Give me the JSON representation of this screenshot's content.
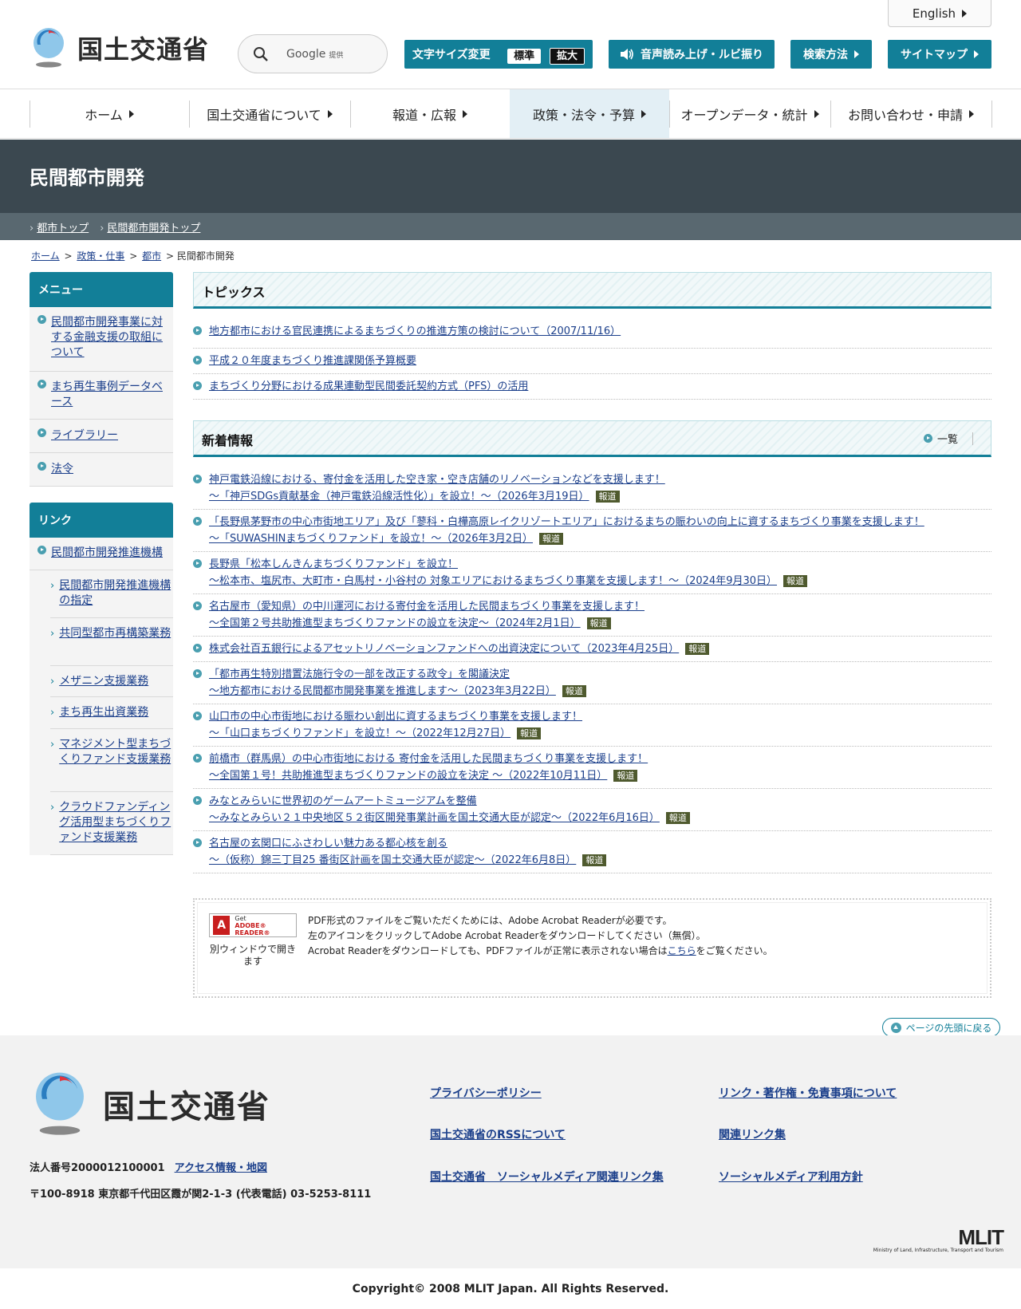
{
  "header": {
    "english_label": "English",
    "logo_text": "国土交通省",
    "search_label": "Google",
    "search_provided": "提供",
    "fontsize_label": "文字サイズ変更",
    "fontsize_standard": "標準",
    "fontsize_large": "拡大",
    "voice_label": "音声読み上げ・ルビ振り",
    "howto_label": "検索方法",
    "sitemap_label": "サイトマップ"
  },
  "nav": {
    "items": [
      "ホーム",
      "国土交通省について",
      "報道・広報",
      "政策・法令・予算",
      "オープンデータ・統計",
      "お問い合わせ・申請"
    ],
    "active_index": 3
  },
  "banner": {
    "title": "民間都市開発",
    "subnav": [
      "都市トップ",
      "民間都市開発トップ"
    ]
  },
  "breadcrumb": {
    "links": [
      "ホーム",
      "政策・仕事",
      "都市"
    ],
    "sep": ">",
    "current": "民間都市開発"
  },
  "sidebar": {
    "menu_title": "メニュー",
    "menu_items": [
      "民間都市開発事業に対する金融支援の取組について",
      "まち再生事例データベース",
      "ライブラリー",
      "法令"
    ],
    "link_title": "リンク",
    "link_items": [
      "民間都市開発推進機構"
    ],
    "link_subitems": [
      "民間都市開発推進機構の指定",
      "共同型都市再構築業務",
      "メザニン支援業務",
      "まち再生出資業務",
      "マネジメント型まちづくりファンド支援業務",
      "クラウドファンディング活用型まちづくりファンド支援業務"
    ]
  },
  "topics": {
    "title": "トピックス",
    "items": [
      "地方都市における官民連携によるまちづくりの推進方策の検討について（2007/11/16）",
      "平成２０年度まちづくり推進課関係予算概要",
      "まちづくり分野における成果連動型民間委託契約方式（PFS）の活用"
    ]
  },
  "news": {
    "title": "新着情報",
    "list_label": "一覧",
    "badge": "報道",
    "items": [
      {
        "line1": "神戸電鉄沿線における、寄付金を活用した空き家・空き店舗のリノベーションなどを支援します！",
        "line2": "～「神戸SDGs貢献基金（神戸電鉄沿線活性化）」を設立！～（2026年3月19日）"
      },
      {
        "line1": "「長野県茅野市の中心市街地エリア」及び「蓼科・白樺高原レイクリゾートエリア」におけるまちの賑わいの向上に資するまちづくり事業を支援します！",
        "line2": "～「SUWASHINまちづくりファンド」を設立！～（2026年3月2日）"
      },
      {
        "line1": "長野県「松本しんきんまちづくりファンド」を設立！",
        "line2": "～松本市、塩尻市、大町市・白馬村・小谷村の 対象エリアにおけるまちづくり事業を支援します！～（2024年9月30日）"
      },
      {
        "line1": "名古屋市（愛知県）の中川運河における寄付金を活用した民間まちづくり事業を支援します！",
        "line2": "～全国第２号共助推進型まちづくりファンドの設立を決定～（2024年2月1日）"
      },
      {
        "line1": "株式会社百五銀行によるアセットリノベーションファンドへの出資決定について（2023年4月25日）",
        "line2": ""
      },
      {
        "line1": "「都市再生特別措置法施行令の一部を改正する政令」を閣議決定",
        "line2": "～地方都市における民間都市開発事業を推進します～（2023年3月22日）"
      },
      {
        "line1": "山口市の中心市街地における賑わい創出に資するまちづくり事業を支援します！",
        "line2": "～「山口まちづくりファンド」を設立！～（2022年12月27日）"
      },
      {
        "line1": "前橋市（群馬県）の中心市街地における 寄付金を活用した民間まちづくり事業を支援します！",
        "line2": "～全国第１号！共助推進型まちづくりファンドの設立を決定 ～（2022年10月11日）"
      },
      {
        "line1": "みなとみらいに世界初のゲームアートミュージアムを整備",
        "line2": "～みなとみらい２１中央地区５２街区開発事業計画を国土交通大臣が認定～（2022年6月16日）"
      },
      {
        "line1": "名古屋の玄関口にふさわしい魅力ある都心核を創る",
        "line2": "～（仮称）錦三丁目25 番街区計画を国土交通大臣が認定～（2022年6月8日）"
      }
    ]
  },
  "pdf": {
    "get_label": "Get",
    "reader_label": "ADOBE® READER®",
    "new_window": "別ウィンドウで開きます",
    "line1": "PDF形式のファイルをご覧いただくためには、Adobe Acrobat Readerが必要です。",
    "line2": "左のアイコンをクリックしてAdobe Acrobat Readerをダウンロードしてください（無償）。",
    "line3_pre": "Acrobat Readerをダウンロードしても、PDFファイルが正常に表示されない場合は",
    "line3_link": "こちら",
    "line3_post": "をご覧ください。"
  },
  "to_top": "ページの先頭に戻る",
  "footer": {
    "logo_text": "国土交通省",
    "corp_number": "法人番号2000012100001",
    "access_link": "アクセス情報・地図",
    "address": "〒100-8918 東京都千代田区霞が関2-1-3 (代表電話) 03-5253-8111",
    "links": [
      "プライバシーポリシー",
      "リンク・著作権・免責事項について",
      "国土交通省のRSSについて",
      "関連リンク集",
      "国土交通省　ソーシャルメディア関連リンク集",
      "ソーシャルメディア利用方針"
    ],
    "mlit": "MLIT",
    "mlit_sub": "Ministry of Land, Infrastructure, Transport and Tourism",
    "copyright": "Copyright© 2008 MLIT Japan. All Rights Reserved."
  },
  "colors": {
    "accent": "#127f98",
    "banner": "#3b4850",
    "subbanner": "#596870",
    "badge": "#4f5a2e",
    "link": "#1b3f8b"
  },
  "icons": [
    "logo-mark",
    "search-icon",
    "speaker-icon",
    "triangle-right-icon",
    "circle-arrow-icon",
    "chevron-right-icon",
    "pdf-icon",
    "arrow-up-icon"
  ]
}
